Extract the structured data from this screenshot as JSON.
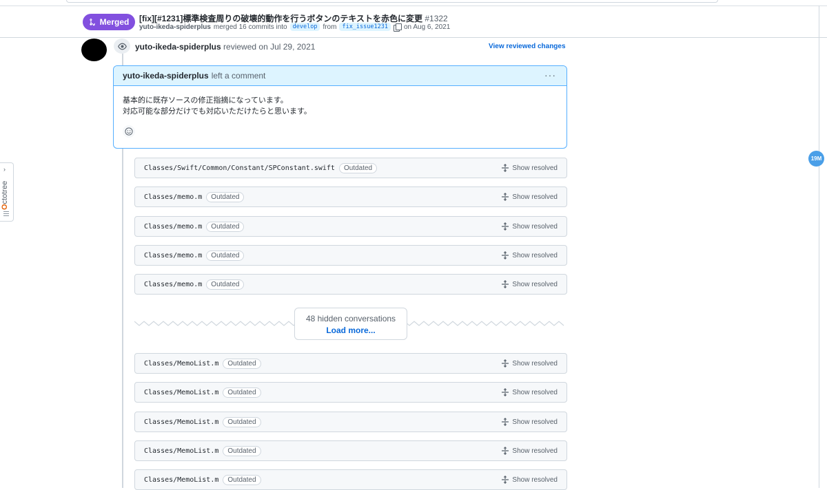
{
  "pr": {
    "status": "Merged",
    "title": "[fix][#1231]標準検査周りの破壊的動作を行うボタンのテキストを赤色に変更",
    "number": "#1322",
    "author": "yuto-ikeda-spiderplus",
    "merged_text": "merged 16 commits into",
    "base_branch": "develop",
    "from_text": "from",
    "head_branch": "fix_issue1231",
    "date_text": "on Aug 6, 2021",
    "accent_color": "#8250df"
  },
  "review": {
    "author": "yuto-ikeda-spiderplus",
    "action": "reviewed on Jul 29, 2021",
    "view_changes_label": "View reviewed changes"
  },
  "comment": {
    "author": "yuto-ikeda-spiderplus",
    "action": "left a comment",
    "menu_label": "···",
    "lines": [
      "基本的に既存ソースの修正指摘になっています。",
      "対応可能な部分だけでも対応いただけたらと思います。"
    ]
  },
  "threads": [
    {
      "path": "Classes/Swift/Common/Constant/SPConstant.swift",
      "badge": "Outdated",
      "action": "Show resolved"
    },
    {
      "path": "Classes/memo.m",
      "badge": "Outdated",
      "action": "Show resolved"
    },
    {
      "path": "Classes/memo.m",
      "badge": "Outdated",
      "action": "Show resolved"
    },
    {
      "path": "Classes/memo.m",
      "badge": "Outdated",
      "action": "Show resolved"
    },
    {
      "path": "Classes/memo.m",
      "badge": "Outdated",
      "action": "Show resolved"
    },
    {
      "path": "Classes/MemoList.m",
      "badge": "Outdated",
      "action": "Show resolved"
    },
    {
      "path": "Classes/MemoList.m",
      "badge": "Outdated",
      "action": "Show resolved"
    },
    {
      "path": "Classes/MemoList.m",
      "badge": "Outdated",
      "action": "Show resolved"
    },
    {
      "path": "Classes/MemoList.m",
      "badge": "Outdated",
      "action": "Show resolved"
    },
    {
      "path": "Classes/MemoList.m",
      "badge": "Outdated",
      "action": "Show resolved"
    }
  ],
  "hidden": {
    "count_text": "48 hidden conversations",
    "load_more": "Load more..."
  },
  "octotree": {
    "label_first": "O",
    "label_rest": "ctotree"
  },
  "floating_badge": "19M"
}
